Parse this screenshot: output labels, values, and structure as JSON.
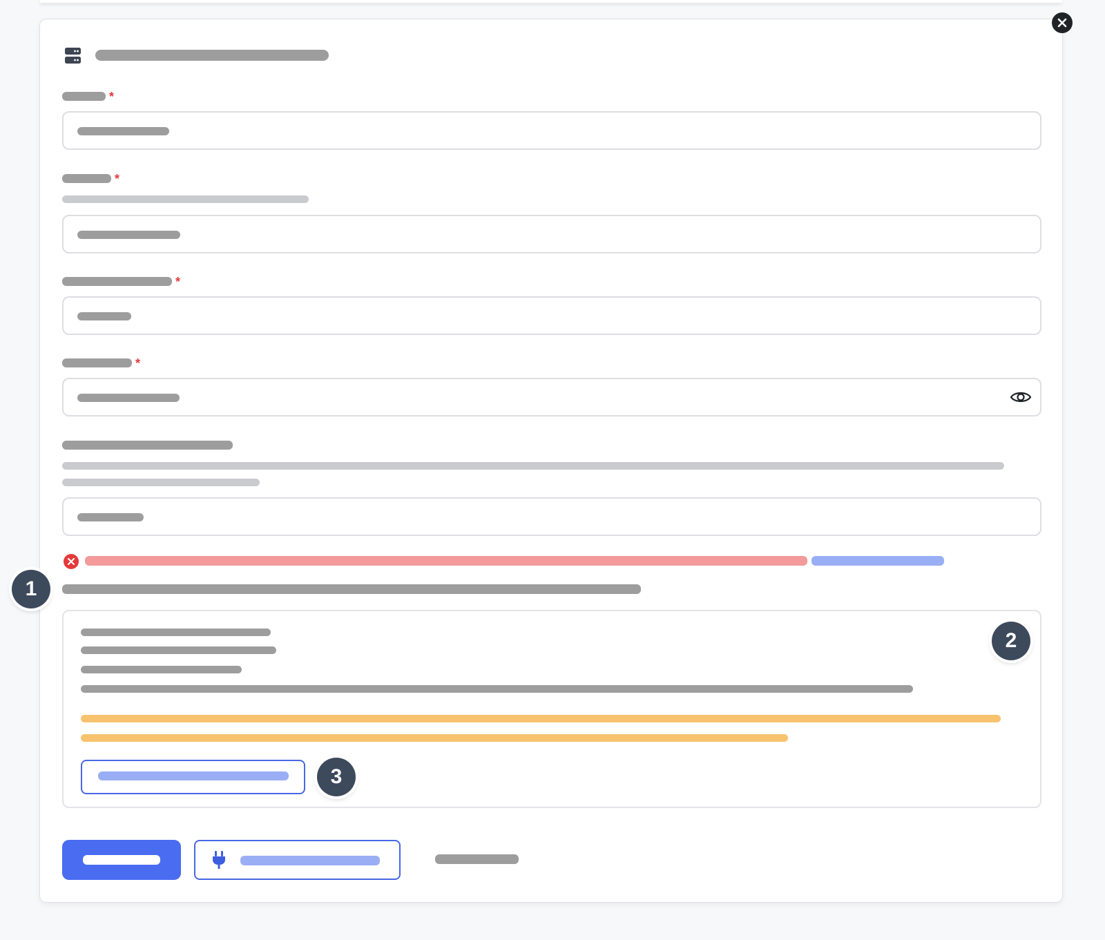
{
  "annotations": {
    "marker_1": "1",
    "marker_2": "2",
    "marker_3": "3"
  },
  "icons": {
    "form_header": "server-icon",
    "close": "close-icon",
    "password_toggle": "eye-icon",
    "error": "error-x-circle-icon",
    "connect": "plug-icon"
  },
  "colors": {
    "primary": "#4a6cf0",
    "error": "#e5393a",
    "warning": "#f8c36e",
    "link": "#9aaef5",
    "badge": "#3d4a5c"
  }
}
